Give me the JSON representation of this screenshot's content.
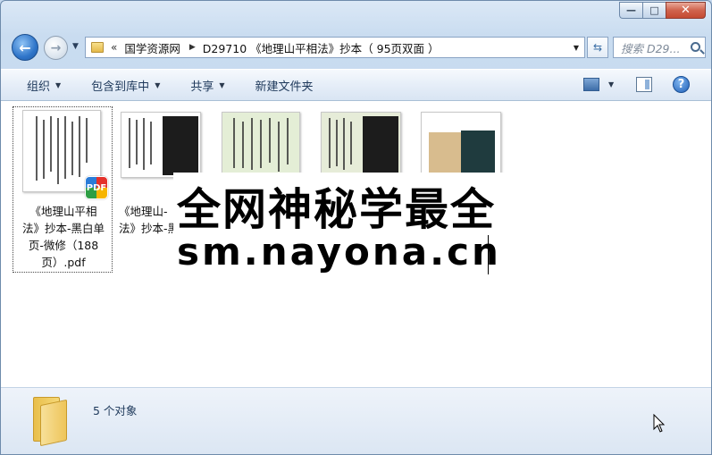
{
  "window": {
    "caption_min": "—",
    "caption_max": "□",
    "caption_close": "✕"
  },
  "nav": {
    "chevron": "«",
    "breadcrumb": [
      "国学资源网",
      "D29710 《地理山平相法》抄本（ 95页双面 ）"
    ],
    "search_placeholder": "搜索 D29..."
  },
  "toolbar": {
    "organize": "组织",
    "include_library": "包含到库中",
    "share": "共享",
    "new_folder": "新建文件夹"
  },
  "files": [
    {
      "label": "《地理山平相法》抄本-黑白单页-微修（188页）.pdf",
      "badge": "PDF"
    },
    {
      "label": "《地理山平相法》抄本-黑"
    },
    {
      "label": ""
    },
    {
      "label": ""
    },
    {
      "label": ""
    }
  ],
  "file1_lines": [
    "《地理山平相",
    "法》抄本-黑白单",
    "页-微修（188",
    "页）.pdf"
  ],
  "file2_lines": [
    "《地理山-",
    "法》抄本-黑"
  ],
  "watermark": {
    "title": "全网神秘学最全",
    "url": "sm.nayona.cn"
  },
  "status": {
    "count_text": "5 个对象"
  }
}
